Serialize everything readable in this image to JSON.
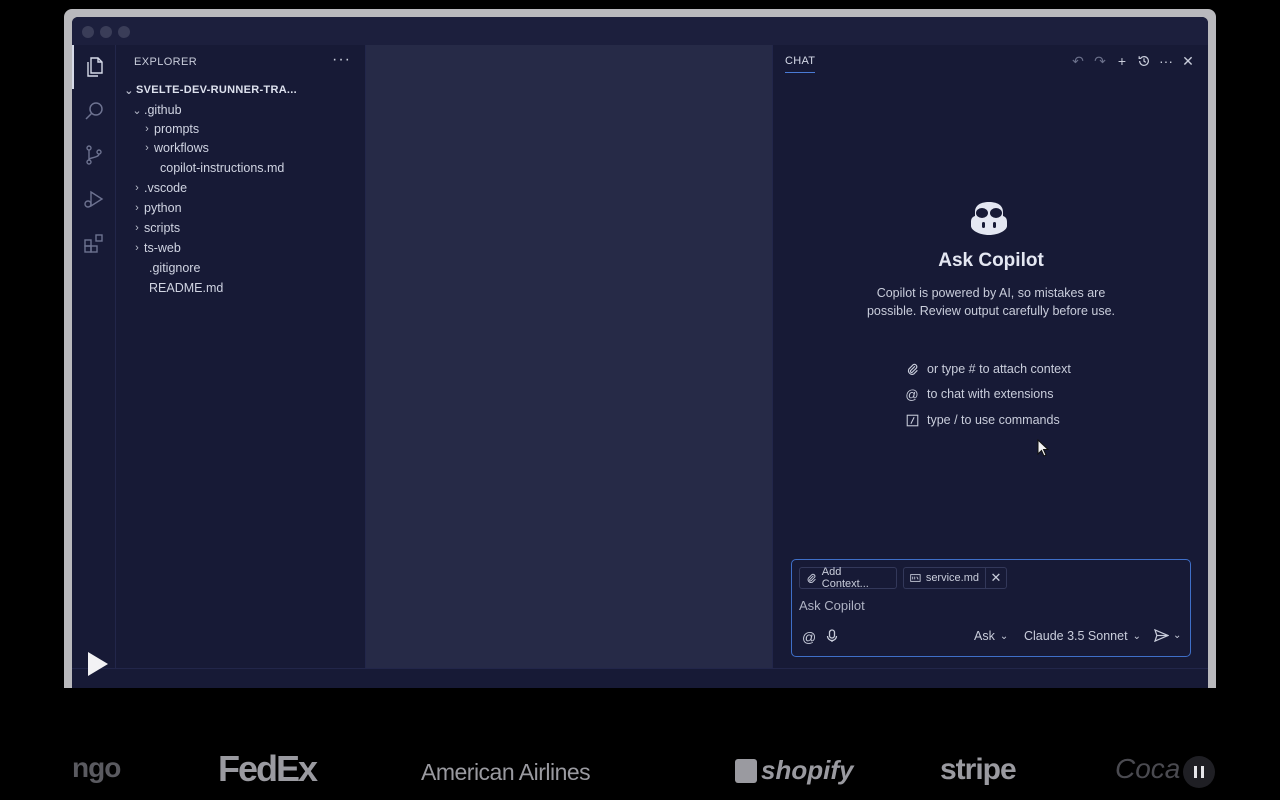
{
  "explorer": {
    "title": "EXPLORER",
    "more": "···",
    "root": "SVELTE-DEV-RUNNER-TRA...",
    "items": [
      {
        "label": ".github",
        "chev": "⌄"
      },
      {
        "label": "prompts",
        "chev": "›"
      },
      {
        "label": "workflows",
        "chev": "›"
      },
      {
        "label": "copilot-instructions.md",
        "chev": ""
      },
      {
        "label": ".vscode",
        "chev": "›"
      },
      {
        "label": "python",
        "chev": "›"
      },
      {
        "label": "scripts",
        "chev": "›"
      },
      {
        "label": "ts-web",
        "chev": "›"
      },
      {
        "label": ".gitignore",
        "chev": ""
      },
      {
        "label": "README.md",
        "chev": ""
      }
    ]
  },
  "chat": {
    "tab": "CHAT",
    "title": "Ask Copilot",
    "description": "Copilot is powered by AI, so mistakes are possible. Review output carefully before use.",
    "hints": [
      {
        "icon": "paperclip-icon",
        "text": "or type # to attach context"
      },
      {
        "icon": "at-icon",
        "text": "to chat with extensions"
      },
      {
        "icon": "slash-command-icon",
        "text": "type / to use commands"
      }
    ],
    "input": {
      "add_context": "Add Context...",
      "attached_file": "service.md",
      "placeholder": "Ask Copilot",
      "mode": "Ask",
      "model": "Claude 3.5 Sonnet"
    }
  },
  "logos": [
    "ngo",
    "FedEx",
    "American Airlines",
    "shopify",
    "stripe",
    "Coca"
  ]
}
